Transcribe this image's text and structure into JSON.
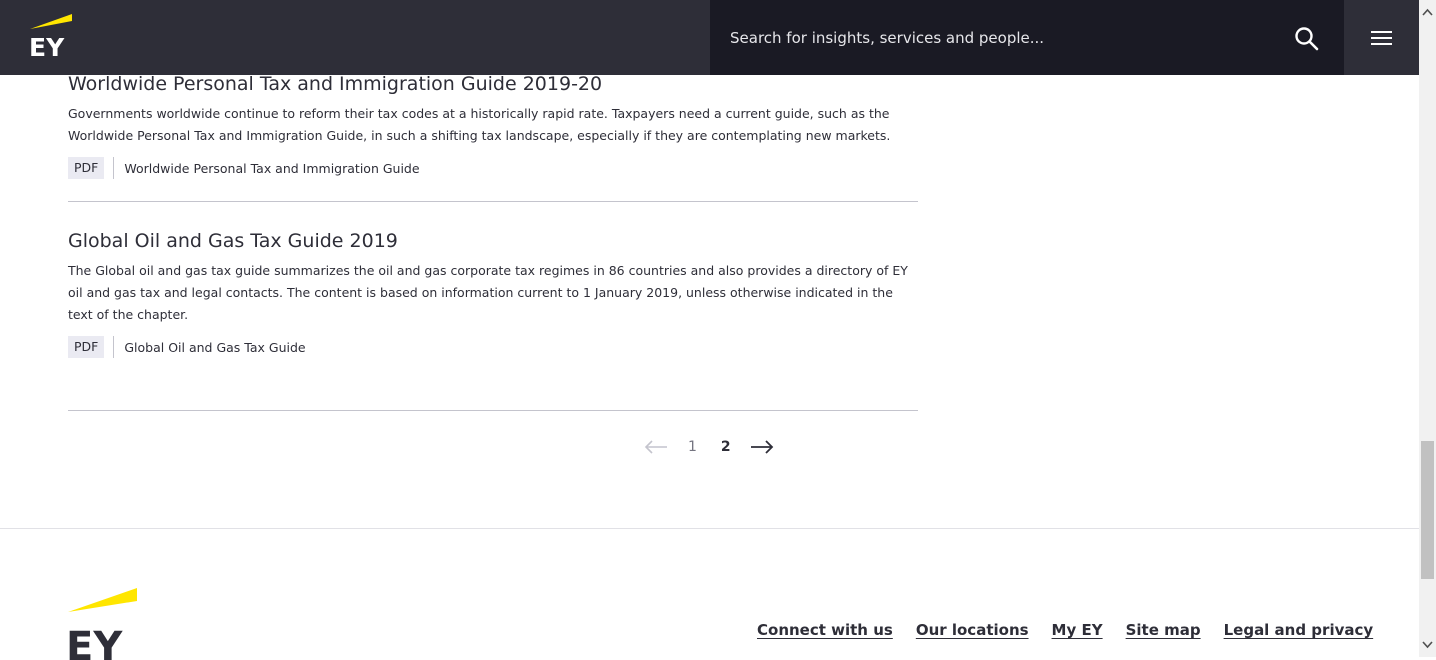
{
  "header": {
    "logo_text": "EY",
    "search_placeholder": "Search for insights, services and people..."
  },
  "articles": [
    {
      "title": "Worldwide Personal Tax and Immigration Guide 2019-20",
      "description": "Governments worldwide continue to reform their tax codes at a historically rapid rate. Taxpayers need a current guide, such as the Worldwide Personal Tax and Immigration Guide, in such a shifting tax landscape, especially if they are contemplating new markets.",
      "doc_type": "PDF",
      "doc_label": "Worldwide Personal Tax and Immigration Guide"
    },
    {
      "title": "Global Oil and Gas Tax Guide 2019",
      "description": "The Global oil and gas tax guide summarizes the oil and gas corporate tax regimes in 86 countries and also provides a directory of EY oil and gas tax and legal contacts. The content is based on information current to 1 January 2019, unless otherwise indicated in the text of the chapter.",
      "doc_type": "PDF",
      "doc_label": "Global Oil and Gas Tax Guide"
    }
  ],
  "pagination": {
    "pages": [
      "1",
      "2"
    ],
    "current_page": "2"
  },
  "footer": {
    "logo_text": "EY",
    "links": [
      "Connect with us",
      "Our locations",
      "My EY",
      "Site map",
      "Legal and privacy"
    ]
  },
  "colors": {
    "brand_dark": "#2e2e38",
    "brand_yellow": "#ffe600",
    "tag_bg": "#eaeaf2"
  }
}
